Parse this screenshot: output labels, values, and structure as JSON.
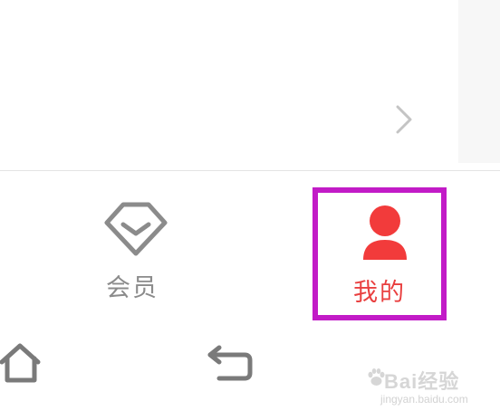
{
  "colors": {
    "accent": "#e93f3f",
    "highlight_border": "#c21bc7",
    "inactive": "#8b8b8b"
  },
  "top_panel": {
    "chevron_icon": "chevron-right-icon"
  },
  "tabbar": {
    "tabs": [
      {
        "label": "会员",
        "icon": "vip-diamond-icon",
        "active": false
      },
      {
        "label": "我的",
        "icon": "user-profile-icon",
        "active": true
      }
    ]
  },
  "system_nav": {
    "home_icon": "home-icon",
    "back_icon": "back-icon"
  },
  "watermark": {
    "brand": "Bai经验",
    "url": "jingyan.baidu.com"
  }
}
